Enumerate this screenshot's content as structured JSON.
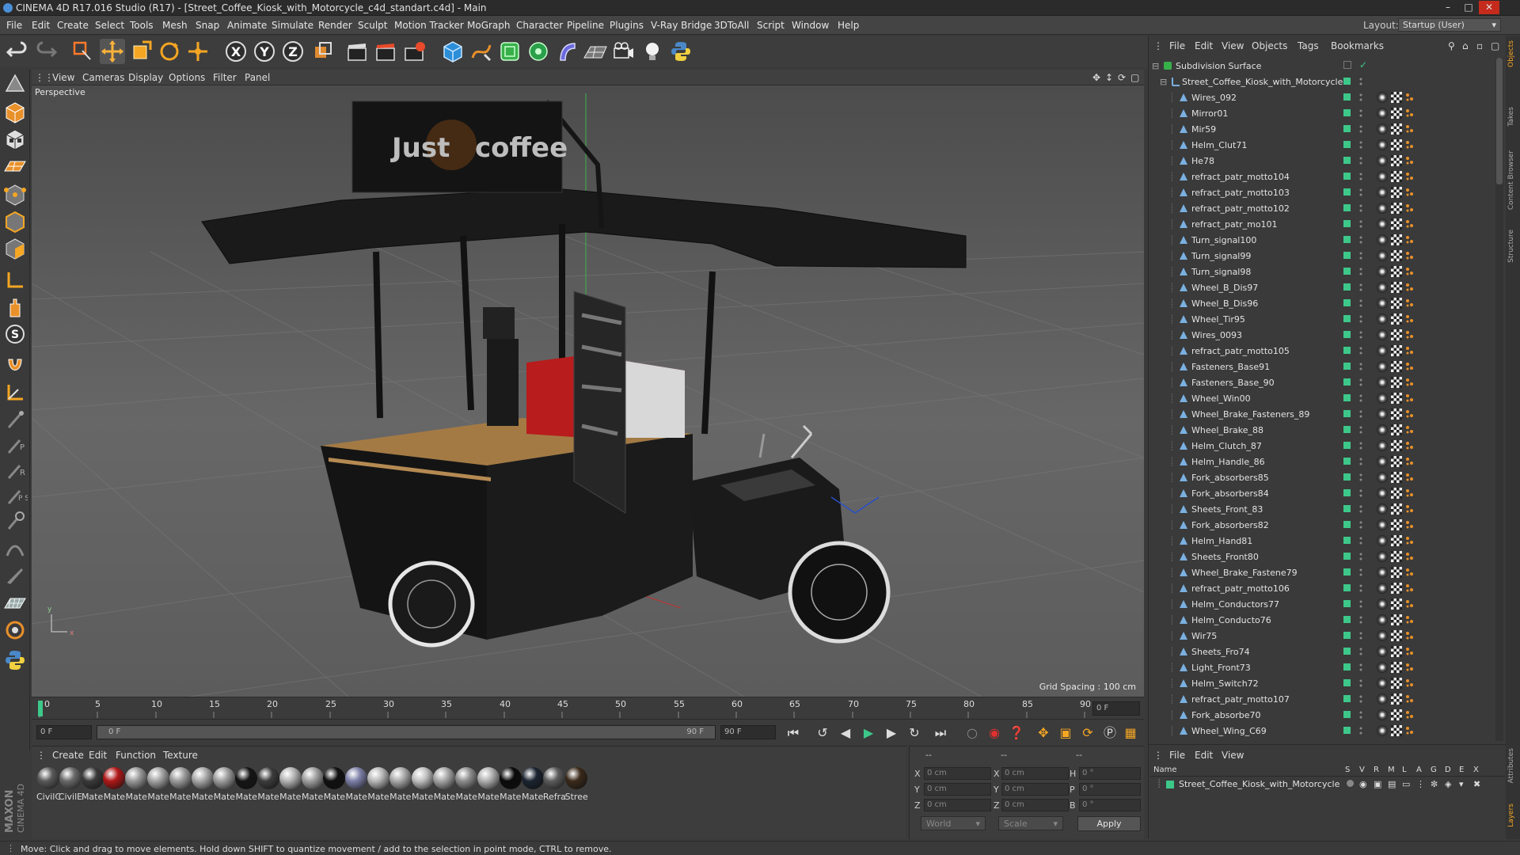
{
  "window": {
    "title": "CINEMA 4D R17.016 Studio (R17) - [Street_Coffee_Kiosk_with_Motorcycle_c4d_standart.c4d] - Main"
  },
  "menu": [
    "File",
    "Edit",
    "Create",
    "Select",
    "Tools",
    "Mesh",
    "Snap",
    "Animate",
    "Simulate",
    "Render",
    "Sculpt",
    "Motion Tracker",
    "MoGraph",
    "Character",
    "Pipeline",
    "Plugins",
    "V-Ray Bridge",
    "3DToAll",
    "Script",
    "Window",
    "Help"
  ],
  "layout": {
    "label": "Layout:",
    "value": "Startup (User)"
  },
  "viewport": {
    "menu": [
      "View",
      "Cameras",
      "Display",
      "Options",
      "Filter",
      "Panel"
    ],
    "label": "Perspective",
    "grid_spacing": "Grid Spacing : 100 cm",
    "sign_left": "Just",
    "sign_right": "coffee"
  },
  "timeline": {
    "ticks": [
      "0",
      "5",
      "10",
      "15",
      "20",
      "25",
      "30",
      "35",
      "40",
      "45",
      "50",
      "55",
      "60",
      "65",
      "70",
      "75",
      "80",
      "85",
      "90"
    ],
    "current_frame": "0 F",
    "start_field": "0 F",
    "range_start": "0 F",
    "range_end": "90 F",
    "end_field": "90 F"
  },
  "materials": {
    "menu": [
      "Create",
      "Edit",
      "Function",
      "Texture"
    ],
    "items": [
      {
        "label": "CivilC",
        "color": "#5a5a5a"
      },
      {
        "label": "CivilE",
        "color": "#6a6a6a"
      },
      {
        "label": "Mate",
        "color": "#3a3a3a"
      },
      {
        "label": "Mate",
        "color": "#b01818"
      },
      {
        "label": "Mate",
        "color": "#9a9a9a"
      },
      {
        "label": "Mate",
        "color": "#a4a4a4"
      },
      {
        "label": "Mate",
        "color": "#9c9c9c"
      },
      {
        "label": "Mate",
        "color": "#a8a8a8"
      },
      {
        "label": "Mate",
        "color": "#9e9e9e"
      },
      {
        "label": "Mate",
        "color": "#151515"
      },
      {
        "label": "Mate",
        "color": "#3c3c3c"
      },
      {
        "label": "Mate",
        "color": "#b4b4b4"
      },
      {
        "label": "Mate",
        "color": "#a0a0a0"
      },
      {
        "label": "Mate",
        "color": "#101010"
      },
      {
        "label": "Mate",
        "color": "#7e80a8"
      },
      {
        "label": "Mate",
        "color": "#b8b8b8"
      },
      {
        "label": "Mate",
        "color": "#aaaaaa"
      },
      {
        "label": "Mate",
        "color": "#c0c0c0"
      },
      {
        "label": "Mate",
        "color": "#a6a6a6"
      },
      {
        "label": "Mate",
        "color": "#8e8e8e"
      },
      {
        "label": "Mate",
        "color": "#b0b0b0"
      },
      {
        "label": "Mate",
        "color": "#0a0a0a"
      },
      {
        "label": "Mate",
        "color": "#1b2430"
      },
      {
        "label": "Refra",
        "color": "#5c5c5c"
      },
      {
        "label": "Stree",
        "color": "#3a2a1a"
      }
    ]
  },
  "coordinates": {
    "header_a": "--",
    "header_b": "--",
    "header_c": "--",
    "x_label": "X",
    "y_label": "Y",
    "z_label": "Z",
    "h_label": "H",
    "p_label": "P",
    "b_label": "B",
    "pos_x": "0 cm",
    "pos_y": "0 cm",
    "pos_z": "0 cm",
    "size_x": "0 cm",
    "size_y": "0 cm",
    "size_z": "0 cm",
    "rot_h": "0 °",
    "rot_p": "0 °",
    "rot_b": "0 °",
    "mode": "World",
    "size_mode": "Scale",
    "apply": "Apply"
  },
  "object_manager": {
    "menu": [
      "File",
      "Edit",
      "View",
      "Objects",
      "Tags",
      "Bookmarks"
    ],
    "root": "Subdivision Surface",
    "group": "Street_Coffee_Kiosk_with_Motorcycle",
    "objects": [
      "Wires_092",
      "Mirror01",
      "Mir59",
      "Helm_Clut71",
      "He78",
      "refract_patr_motto104",
      "refract_patr_motto103",
      "refract_patr_motto102",
      "refract_patr_mo101",
      "Turn_signal100",
      "Turn_signal99",
      "Turn_signal98",
      "Wheel_B_Dis97",
      "Wheel_B_Dis96",
      "Wheel_Tir95",
      "Wires_0093",
      "refract_patr_motto105",
      "Fasteners_Base91",
      "Fasteners_Base_90",
      "Wheel_Win00",
      "Wheel_Brake_Fasteners_89",
      "Wheel_Brake_88",
      "Helm_Clutch_87",
      "Helm_Handle_86",
      "Fork_absorbers85",
      "Fork_absorbers84",
      "Sheets_Front_83",
      "Fork_absorbers82",
      "Helm_Hand81",
      "Sheets_Front80",
      "Wheel_Brake_Fastene79",
      "refract_patr_motto106",
      "Helm_Conductors77",
      "Helm_Conducto76",
      "Wir75",
      "Sheets_Fro74",
      "Light_Front73",
      "Helm_Switch72",
      "refract_patr_motto107",
      "Fork_absorbe70",
      "Wheel_Wing_C69"
    ]
  },
  "right_tabs": [
    "Objects",
    "Takes",
    "Content Browser",
    "Structure"
  ],
  "right_tabs_bottom": [
    "Attributes",
    "Layers"
  ],
  "layer_manager": {
    "menu": [
      "File",
      "Edit",
      "View"
    ],
    "columns": [
      "Name",
      "S",
      "V",
      "R",
      "M",
      "L",
      "A",
      "G",
      "D",
      "E",
      "X"
    ],
    "row": "Street_Coffee_Kiosk_with_Motorcycle"
  },
  "status": "Move: Click and drag to move elements. Hold down SHIFT to quantize movement / add to the selection in point mode, CTRL to remove."
}
